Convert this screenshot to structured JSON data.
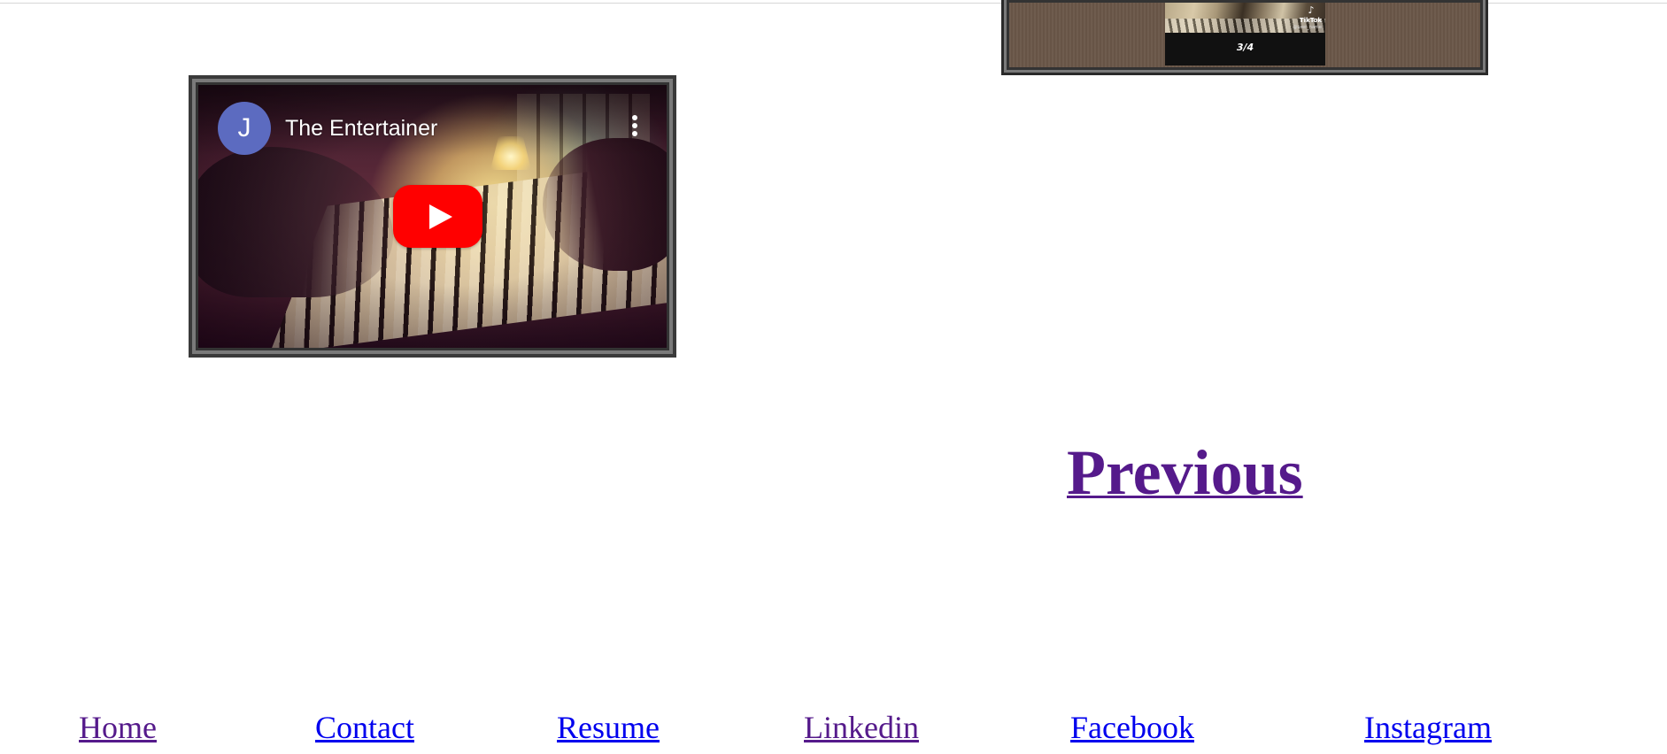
{
  "video_left": {
    "channel_initial": "J",
    "title": "The Entertainer",
    "avatar_color": "#5c6bc0",
    "play_button_color": "#ff0000",
    "icons": [
      "more-vert-icon",
      "play-icon"
    ]
  },
  "video_right": {
    "brand": "TikTok",
    "handle": "@user_name",
    "counter": "3/4",
    "icons": [
      "tiktok-logo-icon"
    ]
  },
  "previous": {
    "label": "Previous"
  },
  "footer": {
    "links": [
      {
        "label": "Home",
        "state": "visited"
      },
      {
        "label": "Contact",
        "state": "unvisited"
      },
      {
        "label": "Resume",
        "state": "unvisited"
      },
      {
        "label": "Linkedin",
        "state": "visited"
      },
      {
        "label": "Facebook",
        "state": "unvisited"
      },
      {
        "label": "Instagram",
        "state": "unvisited"
      }
    ]
  },
  "colors": {
    "link_visited": "#551a8b",
    "link_unvisited": "#0000ee",
    "frame_border": "#3a3a3a",
    "frame_highlight": "#7a7a7a"
  }
}
